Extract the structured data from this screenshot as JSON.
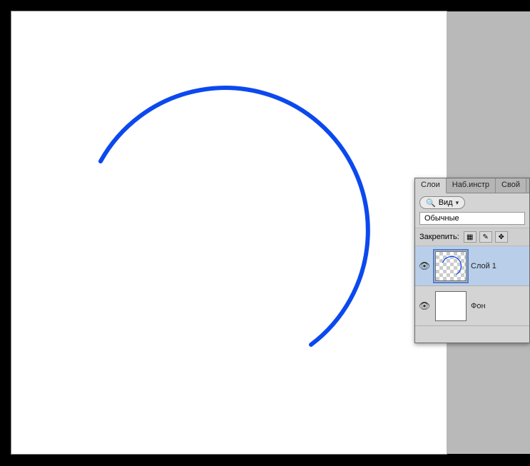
{
  "panel": {
    "tabs": {
      "layers": "Слои",
      "tool_presets": "Наб.инстр",
      "properties": "Свой"
    },
    "filter_label": "Вид",
    "blend_mode": "Обычные",
    "lock_label": "Закрепить:"
  },
  "layers": {
    "items": [
      {
        "name": "Слой 1"
      },
      {
        "name": "Фон"
      }
    ]
  },
  "colors": {
    "stroke": "#0b49ef"
  }
}
